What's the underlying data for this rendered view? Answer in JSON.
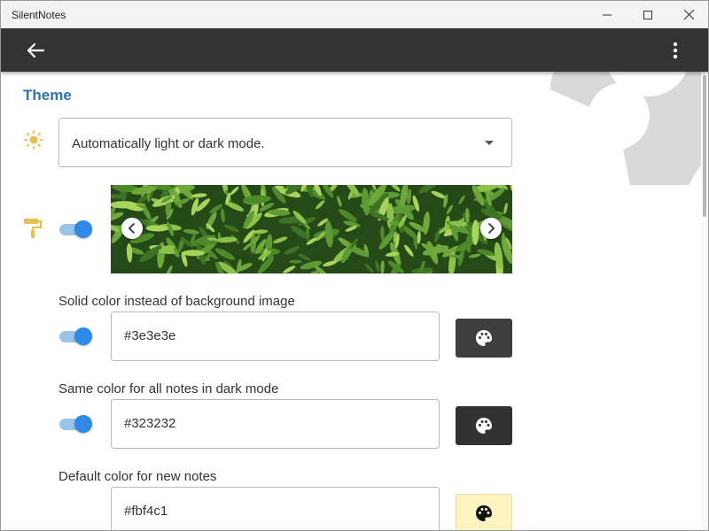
{
  "window": {
    "title": "SilentNotes"
  },
  "appbar": {
    "back_icon": "arrow-left-icon",
    "menu_icon": "more-vertical-icon"
  },
  "theme": {
    "section_title": "Theme",
    "mode_select": {
      "icon": "sun-icon",
      "value": "Automatically light or dark mode."
    },
    "background_image": {
      "icon": "paint-roller-icon",
      "enabled": true
    },
    "solid_color": {
      "label": "Solid color instead of background image",
      "enabled": true,
      "value": "#3e3e3e",
      "swatch": "#3e3e3e"
    },
    "dark_note_color": {
      "label": "Same color for all notes in dark mode",
      "enabled": true,
      "value": "#323232",
      "swatch": "#323232"
    },
    "default_note_color": {
      "label": "Default color for new notes",
      "value": "#fbf4c1",
      "swatch": "#fbf4c1"
    }
  },
  "colors": {
    "accent": "#2b73b5",
    "appbar": "#333333",
    "toggle": "#2f8ae5",
    "icon_yellow": "#e8bf4a"
  }
}
